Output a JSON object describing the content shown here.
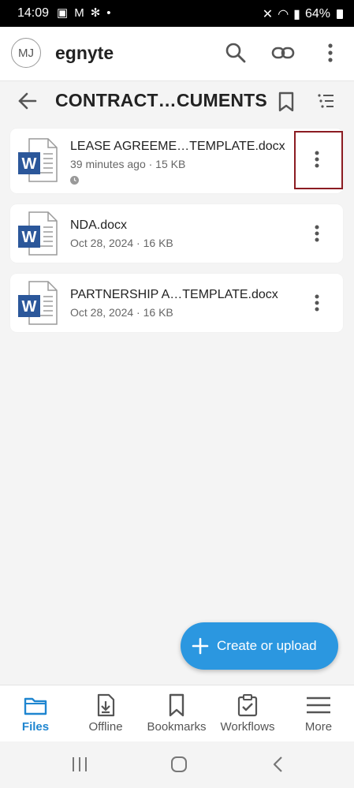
{
  "status": {
    "time": "14:09",
    "battery": "64%"
  },
  "header": {
    "avatar_initials": "MJ",
    "app_name": "egnyte"
  },
  "path": {
    "folder_title": "CONTRACT…CUMENTS"
  },
  "files": [
    {
      "name": "LEASE AGREEME…TEMPLATE.docx",
      "meta": "39 minutes ago · 15 KB",
      "icon": "word-doc-icon",
      "has_clock": true
    },
    {
      "name": "NDA.docx",
      "meta": "Oct 28, 2024 · 16 KB",
      "icon": "word-doc-icon",
      "has_clock": false
    },
    {
      "name": "PARTNERSHIP A…TEMPLATE.docx",
      "meta": "Oct 28, 2024 · 16 KB",
      "icon": "word-doc-icon",
      "has_clock": false
    }
  ],
  "fab": {
    "label": "Create or upload"
  },
  "nav": {
    "files": "Files",
    "offline": "Offline",
    "bookmarks": "Bookmarks",
    "workflows": "Workflows",
    "more": "More"
  },
  "colors": {
    "accent": "#2b97e0",
    "active_nav": "#1f86d0",
    "word_blue": "#2b579a",
    "highlight": "#8b1c22"
  }
}
